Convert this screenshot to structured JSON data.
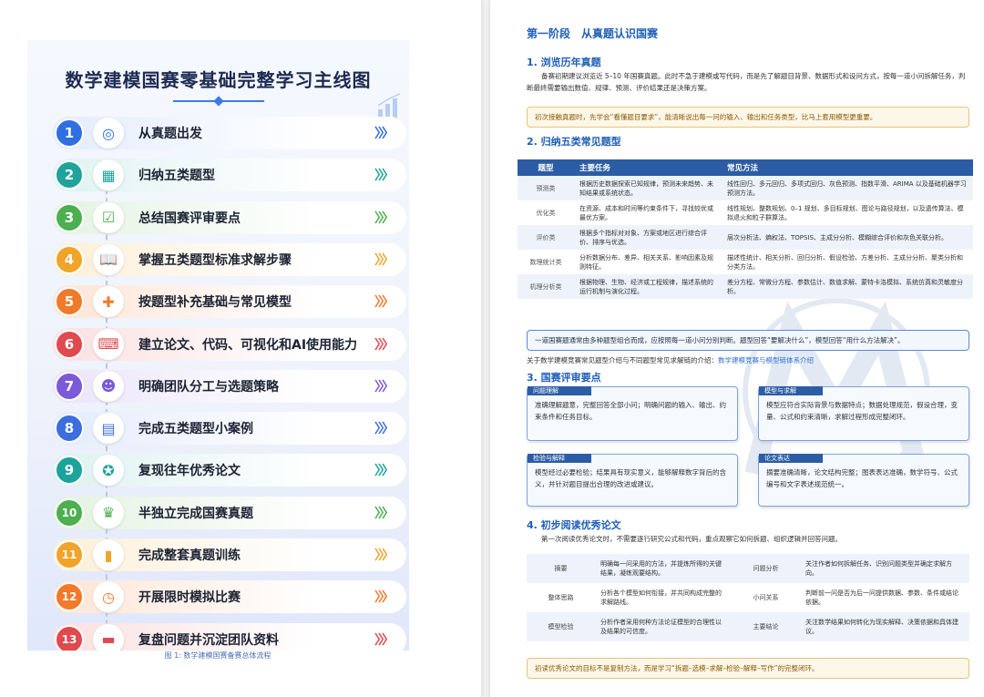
{
  "left": {
    "poster_title": "数学建模国赛零基础完整学习主线图",
    "caption": "图 1: 数学建模国赛备赛总体流程",
    "steps": [
      {
        "num": "1",
        "label": "从真题出发",
        "icon": "target-icon",
        "color": "#2f6fe0",
        "bg": "#e3ecfd"
      },
      {
        "num": "2",
        "label": "归纳五类题型",
        "icon": "grid-icon",
        "color": "#1fa39a",
        "bg": "#dff3f1"
      },
      {
        "num": "3",
        "label": "总结国赛评审要点",
        "icon": "clipboard-check-icon",
        "color": "#4caf50",
        "bg": "#e4f3e2"
      },
      {
        "num": "4",
        "label": "掌握五类题型标准求解步骤",
        "icon": "book-icon",
        "color": "#f0a42a",
        "bg": "#fcefd8"
      },
      {
        "num": "5",
        "label": "按题型补充基础与常见模型",
        "icon": "puzzle-icon",
        "color": "#f07a2a",
        "bg": "#fde5d6"
      },
      {
        "num": "6",
        "label": "建立论文、代码、可视化和AI使用能力",
        "icon": "code-window-icon",
        "color": "#e0494e",
        "bg": "#fbe0e0"
      },
      {
        "num": "7",
        "label": "明确团队分工与选题策略",
        "icon": "team-icon",
        "color": "#7a5ad8",
        "bg": "#ebe4fa"
      },
      {
        "num": "8",
        "label": "完成五类题型小案例",
        "icon": "document-icon",
        "color": "#3b6fe0",
        "bg": "#e3ebfc"
      },
      {
        "num": "9",
        "label": "复现往年优秀论文",
        "icon": "award-icon",
        "color": "#1ca39b",
        "bg": "#ddf2f0"
      },
      {
        "num": "10",
        "label": "半独立完成国赛真题",
        "icon": "trophy-icon",
        "color": "#4caf50",
        "bg": "#e3f2e1"
      },
      {
        "num": "11",
        "label": "完成整套真题训练",
        "icon": "bar-chart-icon",
        "color": "#f0a42a",
        "bg": "#fcefd8"
      },
      {
        "num": "12",
        "label": "开展限时模拟比赛",
        "icon": "clock-icon",
        "color": "#f07a2a",
        "bg": "#fde5d6"
      },
      {
        "num": "13",
        "label": "复盘问题并沉淀团队资料",
        "icon": "folder-icon",
        "color": "#e0494e",
        "bg": "#fbe0e0"
      }
    ]
  },
  "right": {
    "stage_title": "第一阶段　从真题认识国赛",
    "s1_title": "1. 浏览历年真题",
    "s1_para": "备赛初期建议浏览近 5–10 年国赛真题。此时不急于建模或写代码，而是先了解题目背景、数据形式和设问方式，按每一道小问拆解任务，判断最终需要输出数值、规律、预测、评价结果还是决策方案。",
    "s1_tip": "初次接触真题时，先学会“看懂题目要求”，能清晰说出每一问的输入、输出和任务类型，比马上套用模型更重要。",
    "s2_title": "2. 归纳五类常见题型",
    "table_headers": [
      "题型",
      "主要任务",
      "常见方法"
    ],
    "table_rows": [
      [
        "预测类",
        "根据历史数据探索已知规律，预测未来趋势、未知结果或系统状态。",
        "线性回归、多元回归、多项式回归、灰色预测、指数平滑、ARIMA 以及基础机器学习预测方法。"
      ],
      [
        "优化类",
        "在资源、成本和时间等约束条件下，寻找较优或最优方案。",
        "线性规划、整数规划、0–1 规划、多目标规划、图论与路径规划，以及遗传算法、模拟退火和粒子群算法。"
      ],
      [
        "评价类",
        "根据多个指标对对象、方案或地区进行综合评价、排序与优选。",
        "层次分析法、熵权法、TOPSIS、主成分分析、模糊综合评价和灰色关联分析。"
      ],
      [
        "数理统计类",
        "分析数据分布、差异、相关关系、影响因素及规则特征。",
        "描述性统计、相关分析、回归分析、假设检验、方差分析、主成分分析、聚类分析和分类方法。"
      ],
      [
        "机理分析类",
        "根据物理、生物、经济或工程规律，描述系统的运行机制与演化过程。",
        "差分方程、常微分方程、参数估计、数值求解、蒙特卡洛模拟、系统仿真和灵敏度分析。"
      ]
    ],
    "s2_tip": "一道国赛题通常由多种题型组合而成，应按照每一道小问分别判断。题型回答“要解决什么”，模型回答“用什么方法解决”。",
    "link_prefix": "关于数学建模竞赛常见题型介绍与不同题型常见求解链的介绍：",
    "link_text": "数学建模竞赛与模型链体系介绍",
    "s3_title": "3. 国赛评审要点",
    "review_boxes": [
      {
        "head": "问题理解",
        "body": "准确理解题意，完整回答全部小问；明确问题的输入、输出、约束条件和任务目标。"
      },
      {
        "head": "模型与求解",
        "body": "模型应符合实际背景与数据特点；数据处理规范，假设合理，变量、公式和约束清晰，求解过程形成完整闭环。"
      },
      {
        "head": "检验与解释",
        "body": "模型经过必要检验；结果具有现实意义，能够解释数字背后的含义，并针对题目提出合理的改进或建议。"
      },
      {
        "head": "论文表达",
        "body": "摘要准确清晰，论文结构完整；图表表达准确，数学符号、公式编号和文字表述规范统一。"
      }
    ],
    "s4_title": "4. 初步阅读优秀论文",
    "s4_para": "第一次阅读优秀论文时，不需要逐行研究公式和代码，重点观察它如何拆题、组织逻辑并回答问题。",
    "read_rows": [
      [
        "摘要",
        "明确每一问采用的方法，并提炼所得的关键结果，凝练观要结构。",
        "问题分析",
        "关注作者如何拆解任务、识别问题类型并确定求解方向。"
      ],
      [
        "整体思路",
        "分析各个模型如何衔接，并共同构成完整的求解路线。",
        "小问关系",
        "判断前一问是否为后一问提供数据、参数、条件或结论依据。"
      ],
      [
        "模型检验",
        "分析作者采用何种方法论证模型的合理性以及结果的可信度。",
        "主要结论",
        "关注数学结果如何转化为现实解释、决策依据和具体建议。"
      ]
    ],
    "s4_tip": "初读优秀论文的目标不是复制方法，而是学习“拆题–选模–求解–检验–解释–写作”的完整闭环。"
  }
}
